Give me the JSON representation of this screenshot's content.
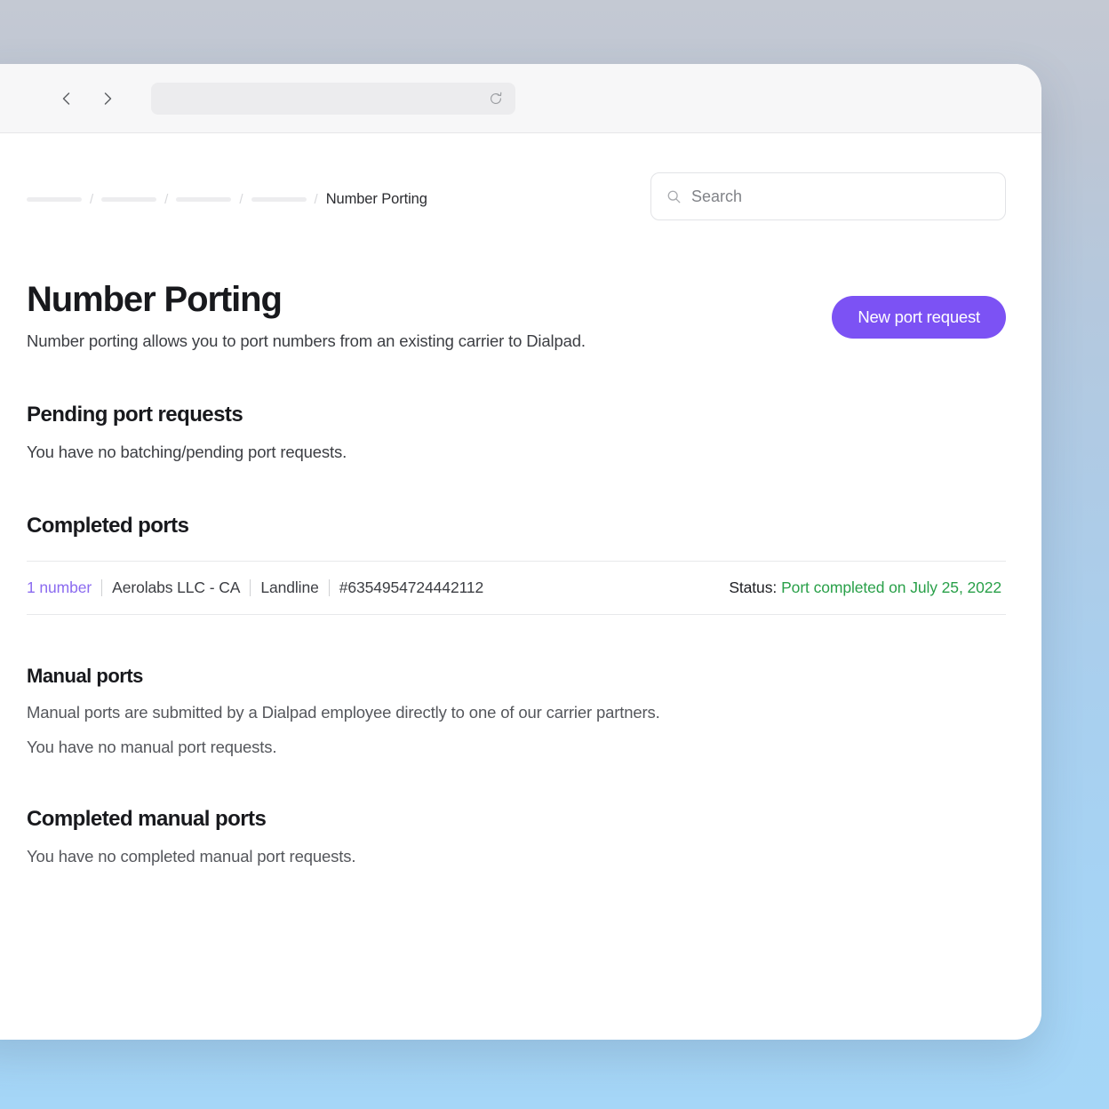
{
  "browser": {
    "back_icon": "chevron-left-icon",
    "forward_icon": "chevron-right-icon",
    "address_value": "",
    "address_placeholder": "",
    "reload_icon": "reload-icon"
  },
  "breadcrumb": {
    "placeholder_count": 4,
    "separator": "/",
    "current": "Number Porting"
  },
  "search": {
    "icon": "search-icon",
    "value": "",
    "placeholder": "Search"
  },
  "header": {
    "title": "Number Porting",
    "subtitle": "Number porting allows you to port numbers from an existing carrier to Dialpad.",
    "primary_button": "New port request"
  },
  "sections": {
    "pending": {
      "title": "Pending port requests",
      "empty_text": "You have no batching/pending port requests."
    },
    "completed": {
      "title": "Completed ports",
      "rows": [
        {
          "number_link": "1 number",
          "carrier": "Aerolabs LLC - CA",
          "line_type": "Landline",
          "port_id": "#6354954724442112",
          "status_label": "Status:",
          "status_value": "Port completed on July 25, 2022"
        }
      ]
    },
    "manual": {
      "title": "Manual ports",
      "description": "Manual ports are submitted by a Dialpad employee directly to one of our carrier partners.",
      "empty_text": "You have no manual port requests."
    },
    "completed_manual": {
      "title": "Completed manual ports",
      "empty_text": "You have no completed manual port requests."
    }
  },
  "colors": {
    "accent_purple": "#7c52f4",
    "link_purple": "#8b6bf0",
    "status_green": "#29a049",
    "text_dark": "#18191d"
  }
}
